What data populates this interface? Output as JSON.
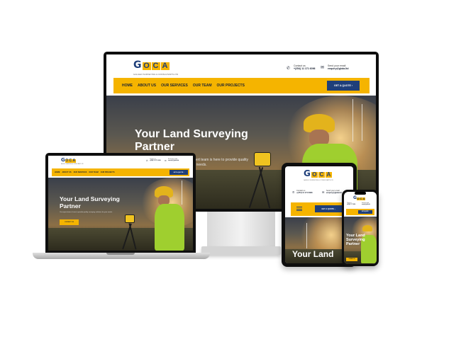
{
  "brand": {
    "logo_text": "G",
    "logo_boxes": [
      "O",
      "C",
      "A"
    ],
    "tagline": "GALILEO SURVEYING & CONSULTANTS LTD"
  },
  "contact": {
    "phone_label": "Contact us",
    "phone": "+(254) 11 171 6096",
    "email_label": "Send your email",
    "email": "enquiry@gkda.ltd"
  },
  "nav": {
    "items": [
      "HOME",
      "ABOUT US",
      "OUR SERVICES",
      "OUR TEAM",
      "OUR PROJECTS"
    ],
    "quote_button": "GET A QUOTE ›"
  },
  "hero": {
    "title_line1": "Your Land Surveying",
    "title_line2": "Partner",
    "subtitle": "Our expert team is here to provide quality surveying solutions for your needs.",
    "subtitle_fragment_1": "expert team is here to provide quality",
    "subtitle_fragment_2": "our needs.",
    "cta": "CONTACT US",
    "tablet_title": "Your Land",
    "phone_title_1": "Your Land",
    "phone_title_2": "Surveying",
    "phone_title_3": "Partner"
  },
  "colors": {
    "accent_yellow": "#f5b400",
    "brand_blue": "#1f3f7a",
    "vest_green": "#9fcf2f"
  },
  "icons": {
    "phone": "phone-icon",
    "email": "email-icon",
    "menu": "hamburger-menu-icon"
  }
}
